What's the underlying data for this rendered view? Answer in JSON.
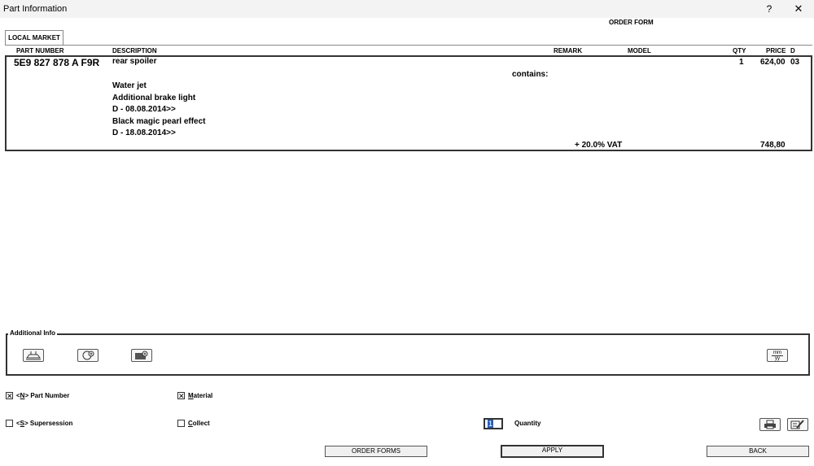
{
  "window": {
    "title": "Part Information",
    "help": "?",
    "close": "✕"
  },
  "form_title": "ORDER FORM",
  "tab": "LOCAL MARKET",
  "columns": [
    "PART NUMBER",
    "DESCRIPTION",
    "REMARK",
    "MODEL",
    "QTY",
    "PRICE",
    "D"
  ],
  "row": {
    "part_number": "5E9 827 878 A  F9R",
    "description": "rear spoiler",
    "qty": "1",
    "price": "624,00",
    "d": "03",
    "contains": "contains:",
    "details": [
      "Water jet",
      "Additional brake light",
      "D - 08.08.2014>>",
      "Black magic pearl effect",
      "D - 18.08.2014>>"
    ]
  },
  "vat": {
    "label": "+ 20.0% VAT",
    "amount": "748,80"
  },
  "additional_info": {
    "label": "Additional Info",
    "icons": [
      "car-lift-icon",
      "wheel-add-icon",
      "camera-add-icon",
      "unit-mm-yy-icon"
    ],
    "unit_top": "mm",
    "unit_bottom": "yy"
  },
  "options": {
    "part_number": {
      "label_pre": "<",
      "key": "N",
      "label_post": "> Part Number",
      "checked": true
    },
    "material": {
      "label_first": "M",
      "label_rest": "aterial",
      "checked": true
    },
    "supersession": {
      "label_pre": "<",
      "key": "S",
      "label_post": "> Supersession",
      "checked": false
    },
    "collect": {
      "label_first": "C",
      "label_rest": "ollect",
      "checked": false
    }
  },
  "quantity": {
    "value": "1",
    "label": "Quantity"
  },
  "buttons": {
    "order_forms": "ORDER FORMS",
    "apply": "APPLY",
    "back": "BACK"
  },
  "tool_icons": [
    "print-icon",
    "edit-icon"
  ]
}
